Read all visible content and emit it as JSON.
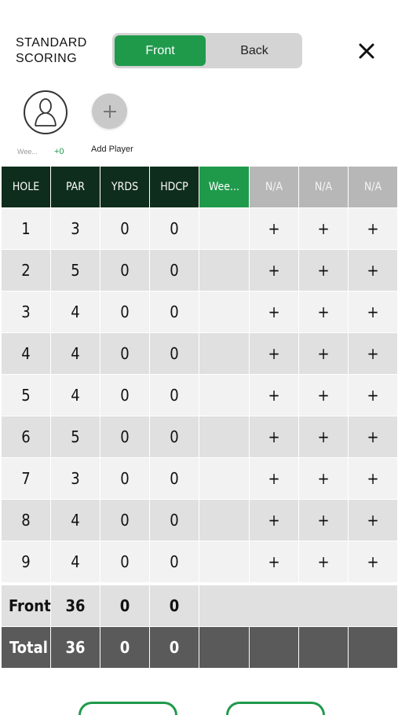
{
  "header": {
    "title": "STANDARD\nSCORING",
    "segment": {
      "front_label": "Front",
      "back_label": "Back",
      "selected": "Front"
    },
    "close_icon": "close-icon"
  },
  "players": {
    "current": {
      "name": "Wee...",
      "score": "+0",
      "icon": "person-icon"
    },
    "add_label": "Add Player",
    "add_icon": "plus-icon"
  },
  "table": {
    "headers": [
      "HOLE",
      "PAR",
      "YRDS",
      "HDCP",
      "Wee...",
      "N/A",
      "N/A",
      "N/A"
    ],
    "holes": [
      {
        "hole": "1",
        "par": "3",
        "yrds": "0",
        "hdcp": "0"
      },
      {
        "hole": "2",
        "par": "5",
        "yrds": "0",
        "hdcp": "0"
      },
      {
        "hole": "3",
        "par": "4",
        "yrds": "0",
        "hdcp": "0"
      },
      {
        "hole": "4",
        "par": "4",
        "yrds": "0",
        "hdcp": "0"
      },
      {
        "hole": "5",
        "par": "4",
        "yrds": "0",
        "hdcp": "0"
      },
      {
        "hole": "6",
        "par": "5",
        "yrds": "0",
        "hdcp": "0"
      },
      {
        "hole": "7",
        "par": "3",
        "yrds": "0",
        "hdcp": "0"
      },
      {
        "hole": "8",
        "par": "4",
        "yrds": "0",
        "hdcp": "0"
      },
      {
        "hole": "9",
        "par": "4",
        "yrds": "0",
        "hdcp": "0"
      }
    ],
    "front": {
      "label": "Front",
      "par": "36",
      "yrds": "0",
      "hdcp": "0"
    },
    "total": {
      "label": "Total",
      "par": "36",
      "yrds": "0",
      "hdcp": "0"
    },
    "empty_cell_symbol": "+"
  },
  "colors": {
    "accent_green": "#1f9a4b",
    "header_dark": "#0f2d1c",
    "na_gray": "#b7b7b7",
    "total_gray": "#5a5a5a"
  }
}
